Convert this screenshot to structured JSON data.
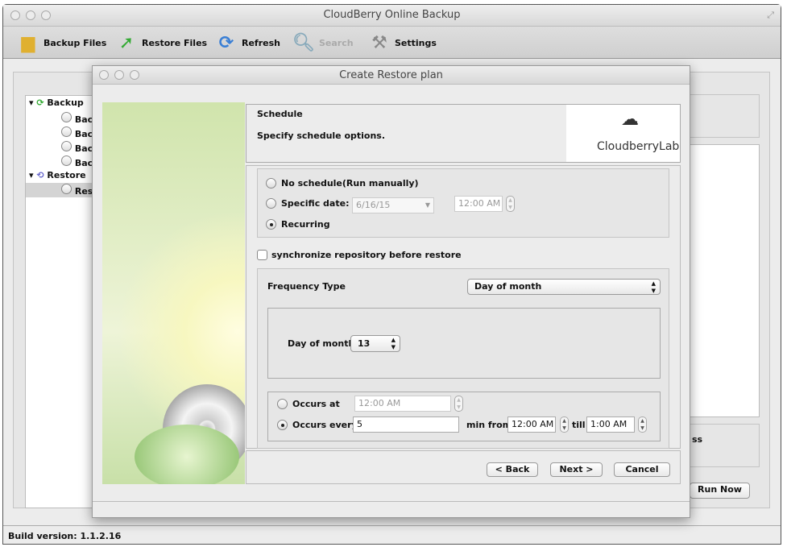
{
  "main_window": {
    "title": "CloudBerry Online Backup",
    "toolbar": [
      {
        "label": "Backup Files",
        "icon": "folder-icon"
      },
      {
        "label": "Restore Files",
        "icon": "green-arrow-icon"
      },
      {
        "label": "Refresh",
        "icon": "refresh-icon"
      },
      {
        "label": "Search",
        "icon": "magnifier-icon",
        "disabled": true
      },
      {
        "label": "Settings",
        "icon": "tools-icon"
      }
    ],
    "tree": {
      "groups": [
        {
          "label": "Backup",
          "items": [
            "Bac",
            "Bac",
            "Bac",
            "Bac"
          ]
        },
        {
          "label": "Restore",
          "items": [
            "Res"
          ]
        }
      ]
    },
    "right_panel_text": "ss",
    "run_now": "Run Now",
    "status": "Build version: 1.1.2.16"
  },
  "dialog": {
    "title": "Create Restore plan",
    "header": {
      "title": "Schedule",
      "subtitle": "Specify schedule options.",
      "logo_text": "CloudberryLab"
    },
    "schedule": {
      "no_schedule": "No schedule(Run manually)",
      "specific_date": "Specific date:",
      "date_value": "6/16/15",
      "time_value": "12:00 AM",
      "recurring": "Recurring",
      "selected": "Recurring"
    },
    "sync_checkbox": {
      "label": "synchronize repository before restore",
      "checked": false
    },
    "frequency": {
      "label": "Frequency Type",
      "value": "Day of month",
      "day_label": "Day of month",
      "day_value": "13"
    },
    "occurs": {
      "at_label": "Occurs at",
      "at_value": "12:00 AM",
      "every_label": "Occurs every",
      "every_value": "5",
      "min_from": "min from",
      "from_value": "12:00 AM",
      "till": "till",
      "till_value": "1:00 AM",
      "selected": "Occurs every"
    },
    "buttons": {
      "back": "< Back",
      "next": "Next >",
      "cancel": "Cancel"
    }
  }
}
